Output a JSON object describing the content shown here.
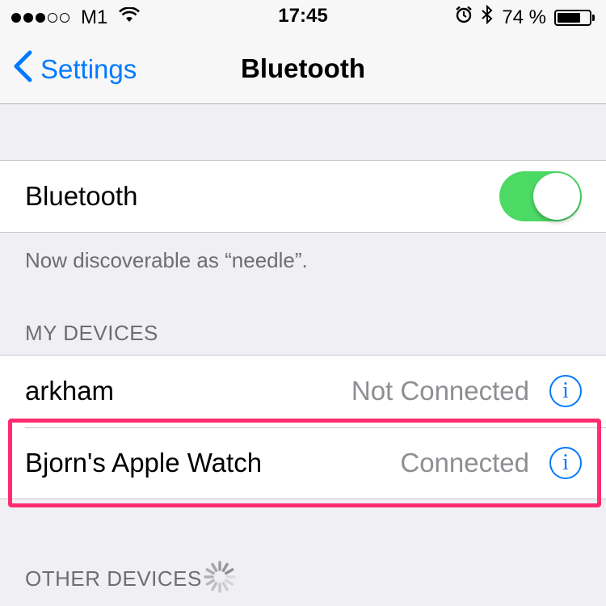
{
  "status_bar": {
    "signal_filled": 3,
    "signal_total": 5,
    "carrier": "M1",
    "time": "17:45",
    "battery_percent": "74 %",
    "battery_level": 0.74,
    "icons": [
      "wifi-icon",
      "alarm-icon",
      "bluetooth-icon",
      "battery-icon"
    ]
  },
  "nav": {
    "back_label": "Settings",
    "title": "Bluetooth"
  },
  "bluetooth_row": {
    "label": "Bluetooth",
    "enabled": true
  },
  "discoverable_text": "Now discoverable as “needle”.",
  "my_devices": {
    "header": "MY DEVICES",
    "items": [
      {
        "name": "arkham",
        "status": "Not Connected"
      },
      {
        "name": "Bjorn's Apple Watch",
        "status": "Connected"
      }
    ]
  },
  "other_devices": {
    "header": "OTHER DEVICES"
  },
  "colors": {
    "accent": "#007aff",
    "toggle_on": "#4cd964",
    "highlight": "#ff2d6e",
    "background": "#efeff4"
  }
}
